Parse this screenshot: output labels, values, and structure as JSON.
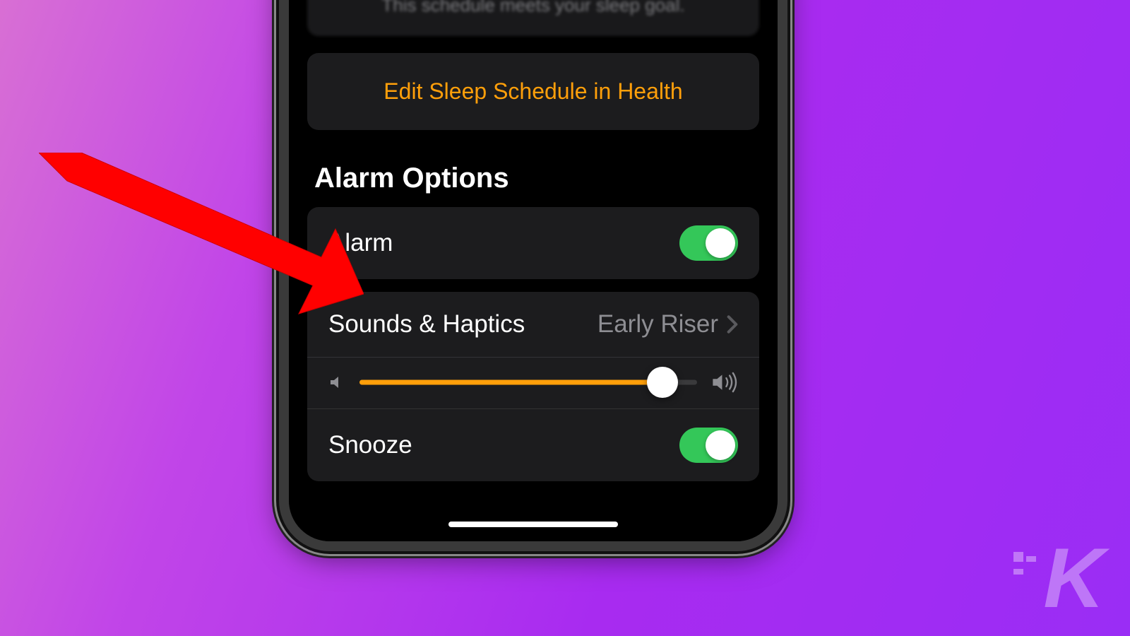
{
  "banner": {
    "text": "This schedule meets your sleep goal."
  },
  "editLink": {
    "label": "Edit Sleep Schedule in Health"
  },
  "section": {
    "title": "Alarm Options"
  },
  "alarm": {
    "label": "Alarm",
    "on": true
  },
  "sounds": {
    "label": "Sounds & Haptics",
    "value": "Early Riser",
    "volumePercent": 88
  },
  "snooze": {
    "label": "Snooze",
    "on": true
  },
  "watermark": {
    "letter": "K"
  }
}
